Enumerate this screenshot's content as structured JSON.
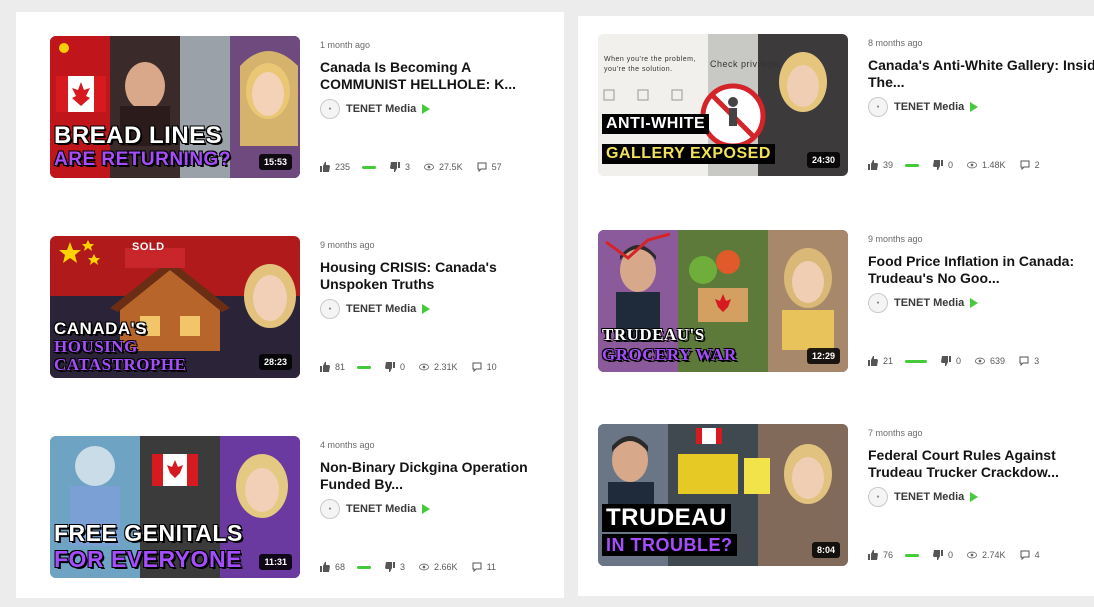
{
  "channel_name": "TENET Media",
  "colors": {
    "verified": "#46c93a",
    "panel": "#ffffff",
    "background": "#ececec"
  },
  "videos": [
    {
      "age": "1 month ago",
      "title": "Canada Is Becoming A COMMUNIST HELLHOLE: K...",
      "duration": "15:53",
      "thumb_line1": "BREAD LINES",
      "thumb_line2": "ARE RETURNING?",
      "likes": "235",
      "dislikes": "3",
      "views": "27.5K",
      "comments": "57"
    },
    {
      "age": "9 months ago",
      "title": "Housing CRISIS: Canada's Unspoken Truths",
      "duration": "28:23",
      "thumb_line1": "CANADA'S",
      "thumb_line2": "HOUSING",
      "thumb_line3": "CATASTROPHE",
      "sign": "SOLD",
      "likes": "81",
      "dislikes": "0",
      "views": "2.31K",
      "comments": "10"
    },
    {
      "age": "4 months ago",
      "title": "Non-Binary Dickgina Operation Funded By...",
      "duration": "11:31",
      "thumb_line1": "FREE GENITALS",
      "thumb_line2": "FOR EVERYONE",
      "likes": "68",
      "dislikes": "3",
      "views": "2.66K",
      "comments": "11"
    },
    {
      "age": "8 months ago",
      "title": "Canada's Anti-White Gallery: Inside The...",
      "duration": "24:30",
      "thumb_line1": "ANTI-WHITE",
      "thumb_line2": "GALLERY EXPOSED",
      "thumb_note1": "When you're the problem,",
      "thumb_note2": "you're the solution.",
      "thumb_note3": "Check privilege",
      "likes": "39",
      "dislikes": "0",
      "views": "1.48K",
      "comments": "2"
    },
    {
      "age": "9 months ago",
      "title": "Food Price Inflation in Canada: Trudeau's No Goo...",
      "duration": "12:29",
      "thumb_line1": "TRUDEAU'S",
      "thumb_line2": "GROCERY WAR",
      "likes": "21",
      "dislikes": "0",
      "views": "639",
      "comments": "3"
    },
    {
      "age": "7 months ago",
      "title": "Federal Court Rules Against Trudeau Trucker Crackdow...",
      "duration": "8:04",
      "thumb_line1": "TRUDEAU",
      "thumb_line2": "IN TROUBLE?",
      "likes": "76",
      "dislikes": "0",
      "views": "2.74K",
      "comments": "4"
    }
  ]
}
